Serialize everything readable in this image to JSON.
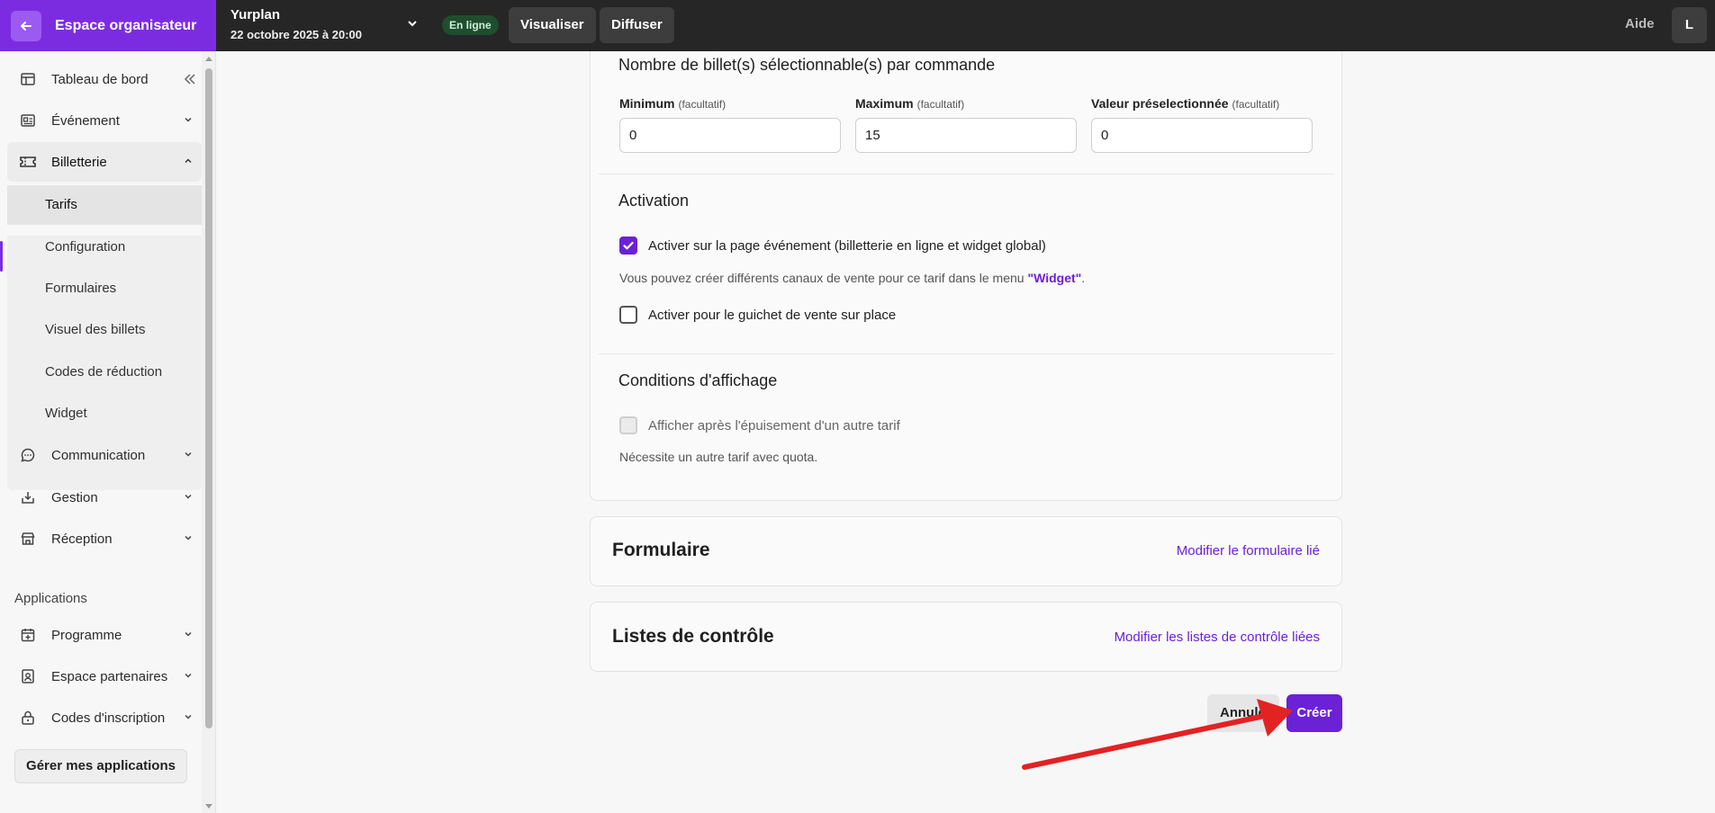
{
  "topbar": {
    "org_label": "Espace organisateur",
    "event_title": "Yurplan",
    "event_date": "22 octobre 2025 à 20:00",
    "status_badge": "En ligne",
    "preview_label": "Visualiser",
    "publish_label": "Diffuser",
    "help_label": "Aide",
    "avatar_initial": "L"
  },
  "sidebar": {
    "dashboard": "Tableau de bord",
    "event": "Événement",
    "ticketing": "Billetterie",
    "ticketing_sub": [
      "Tarifs",
      "Configuration",
      "Formulaires",
      "Visuel des billets",
      "Codes de réduction",
      "Widget"
    ],
    "communication": "Communication",
    "management": "Gestion",
    "reception": "Réception",
    "apps_title": "Applications",
    "program": "Programme",
    "partners": "Espace partenaires",
    "registration_codes": "Codes d'inscription",
    "manage_apps": "Gérer mes applications"
  },
  "main": {
    "quantity_title": "Nombre de billet(s) sélectionnable(s) par commande",
    "optional": "(facultatif)",
    "min_label": "Minimum",
    "min_value": "0",
    "max_label": "Maximum",
    "max_value": "15",
    "preset_label": "Valeur préselectionnée",
    "preset_value": "0",
    "activation_title": "Activation",
    "activate_event_page": "Activer sur la page événement (billetterie en ligne et widget global)",
    "activate_event_page_checked": true,
    "channels_help_before": "Vous pouvez créer différents canaux de vente pour ce tarif dans le menu ",
    "channels_help_link": "\"Widget\"",
    "channels_help_after": ".",
    "activate_box_office": "Activer pour le guichet de vente sur place",
    "activate_box_office_checked": false,
    "display_title": "Conditions d'affichage",
    "show_after_soldout": "Afficher après l'épuisement d'un autre tarif",
    "show_after_soldout_note": "Nécessite un autre tarif avec quota.",
    "form_title": "Formulaire",
    "form_link": "Modifier le formulaire lié",
    "checklists_title": "Listes de contrôle",
    "checklists_link": "Modifier les listes de contrôle liées",
    "cancel_label": "Annuler",
    "create_label": "Créer"
  },
  "colors": {
    "brand": "#7c2ce0",
    "accent": "#6b21d6",
    "topbar": "#262626",
    "annotation_arrow": "#e32222"
  }
}
